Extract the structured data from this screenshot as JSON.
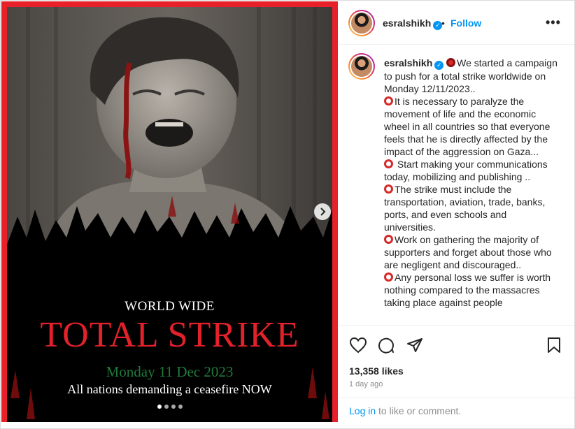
{
  "post": {
    "username": "esralshikh",
    "follow_label": "Follow",
    "header_separator": "•",
    "more_label": "•••",
    "slides": {
      "count": 4,
      "active": 0
    },
    "poster": {
      "line1": "WORLD WIDE",
      "line2": "TOTAL STRIKE",
      "line3": "Monday 11 Dec 2023",
      "line4": "All nations demanding a ceasefire NOW"
    },
    "caption": [
      {
        "icon": "solid",
        "text": "We started a campaign to push for a total strike worldwide on Monday 12/11/2023.."
      },
      {
        "icon": "ring",
        "text": "It is necessary to paralyze the movement of life and the economic wheel in all countries so that everyone feels that he is directly affected by the impact of the aggression on Gaza..."
      },
      {
        "icon": "ring",
        "text": " Start making your communications today, mobilizing and publishing .."
      },
      {
        "icon": "ring",
        "text": "The strike must include the transportation, aviation, trade, banks, ports, and even schools and universities."
      },
      {
        "icon": "ring",
        "text": "Work on gathering the majority of supporters and forget about those who are negligent and discouraged.."
      },
      {
        "icon": "ring",
        "text": "Any personal loss we suffer is worth nothing compared to the massacres taking place against people"
      }
    ],
    "likes": "13,358 likes",
    "time_ago": "1 day ago",
    "login_link": "Log in",
    "login_rest": " to like or comment.",
    "colors": {
      "accent": "#0095f6",
      "poster_red": "#e3212b",
      "poster_green": "#1f7a3a",
      "frame_red": "#e8202a"
    },
    "icons": [
      "verified-badge-icon",
      "heart-icon",
      "comment-icon",
      "share-icon",
      "bookmark-icon",
      "chevron-right-icon"
    ]
  }
}
